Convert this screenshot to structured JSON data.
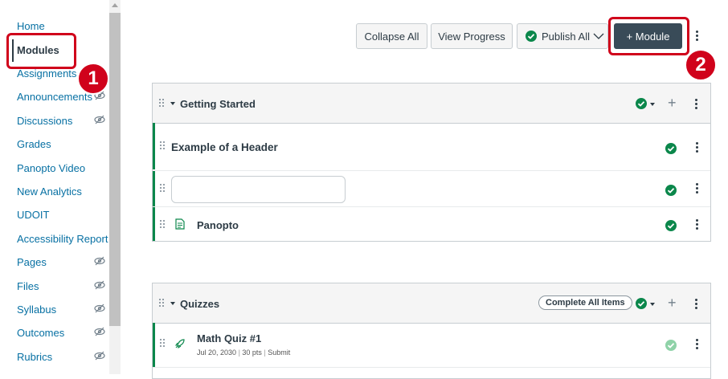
{
  "sidebar": {
    "items": [
      {
        "label": "Home",
        "hidden": false,
        "active": false
      },
      {
        "label": "Modules",
        "hidden": false,
        "active": true
      },
      {
        "label": "Assignments",
        "hidden": false,
        "active": false
      },
      {
        "label": "Announcements",
        "hidden": true,
        "active": false
      },
      {
        "label": "Discussions",
        "hidden": true,
        "active": false
      },
      {
        "label": "Grades",
        "hidden": false,
        "active": false
      },
      {
        "label": "Panopto Video",
        "hidden": false,
        "active": false
      },
      {
        "label": "New Analytics",
        "hidden": false,
        "active": false
      },
      {
        "label": "UDOIT",
        "hidden": false,
        "active": false
      },
      {
        "label": "Accessibility Report",
        "hidden": false,
        "active": false
      },
      {
        "label": "Pages",
        "hidden": true,
        "active": false
      },
      {
        "label": "Files",
        "hidden": true,
        "active": false
      },
      {
        "label": "Syllabus",
        "hidden": true,
        "active": false
      },
      {
        "label": "Outcomes",
        "hidden": true,
        "active": false
      },
      {
        "label": "Rubrics",
        "hidden": true,
        "active": false
      }
    ]
  },
  "toolbar": {
    "collapse_all": "Collapse All",
    "view_progress": "View Progress",
    "publish_all": "Publish All",
    "add_module": "+ Module"
  },
  "callouts": {
    "one": "1",
    "two": "2"
  },
  "modules": [
    {
      "title": "Getting Started",
      "items": [
        {
          "type": "header",
          "title": "Example of a Header"
        },
        {
          "type": "input",
          "value": "",
          "placeholder": ""
        },
        {
          "type": "page",
          "title": "Panopto"
        }
      ]
    },
    {
      "title": "Quizzes",
      "complete_all": "Complete All Items",
      "items": [
        {
          "type": "quiz",
          "title": "Math Quiz #1",
          "date": "Jul 20, 2030",
          "points": "30 pts",
          "action": "Submit"
        }
      ]
    }
  ],
  "colors": {
    "accent": "#0770a3",
    "publish_green": "#0b874b",
    "callout_red": "#d0021b",
    "dark_button": "#394b58"
  }
}
